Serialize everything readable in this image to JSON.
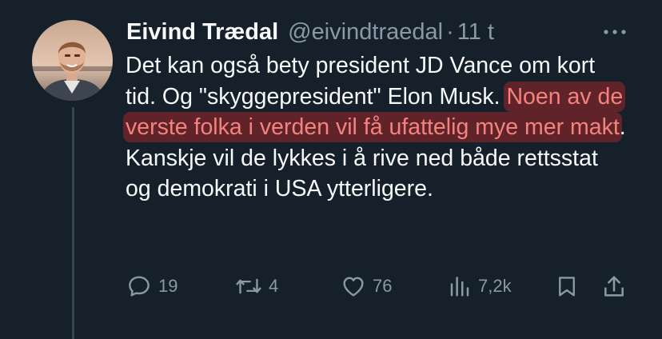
{
  "tweet": {
    "author_name": "Eivind Trædal",
    "author_handle": "@eivindtraedal",
    "separator": "·",
    "time": "11 t",
    "text_before": "Det kan også bety president JD Vance om kort tid. Og \"skyggepresident\" Elon Musk. ",
    "text_highlighted": "Noen av de verste folka i verden vil få ufattelig mye mer makt",
    "text_after": ". Kanskje vil de lykkes i å rive ned både rettsstat og demokrati i USA ytterligere.",
    "highlight_color": "#e0302a"
  },
  "actions": {
    "replies": "19",
    "reposts": "4",
    "likes": "76",
    "views": "7,2k"
  },
  "colors": {
    "background": "#15202b",
    "text": "#f7f9f9",
    "muted": "#8b98a5"
  },
  "icons": [
    "more-icon",
    "reply-icon",
    "repost-icon",
    "like-icon",
    "views-icon",
    "bookmark-icon",
    "share-icon"
  ]
}
